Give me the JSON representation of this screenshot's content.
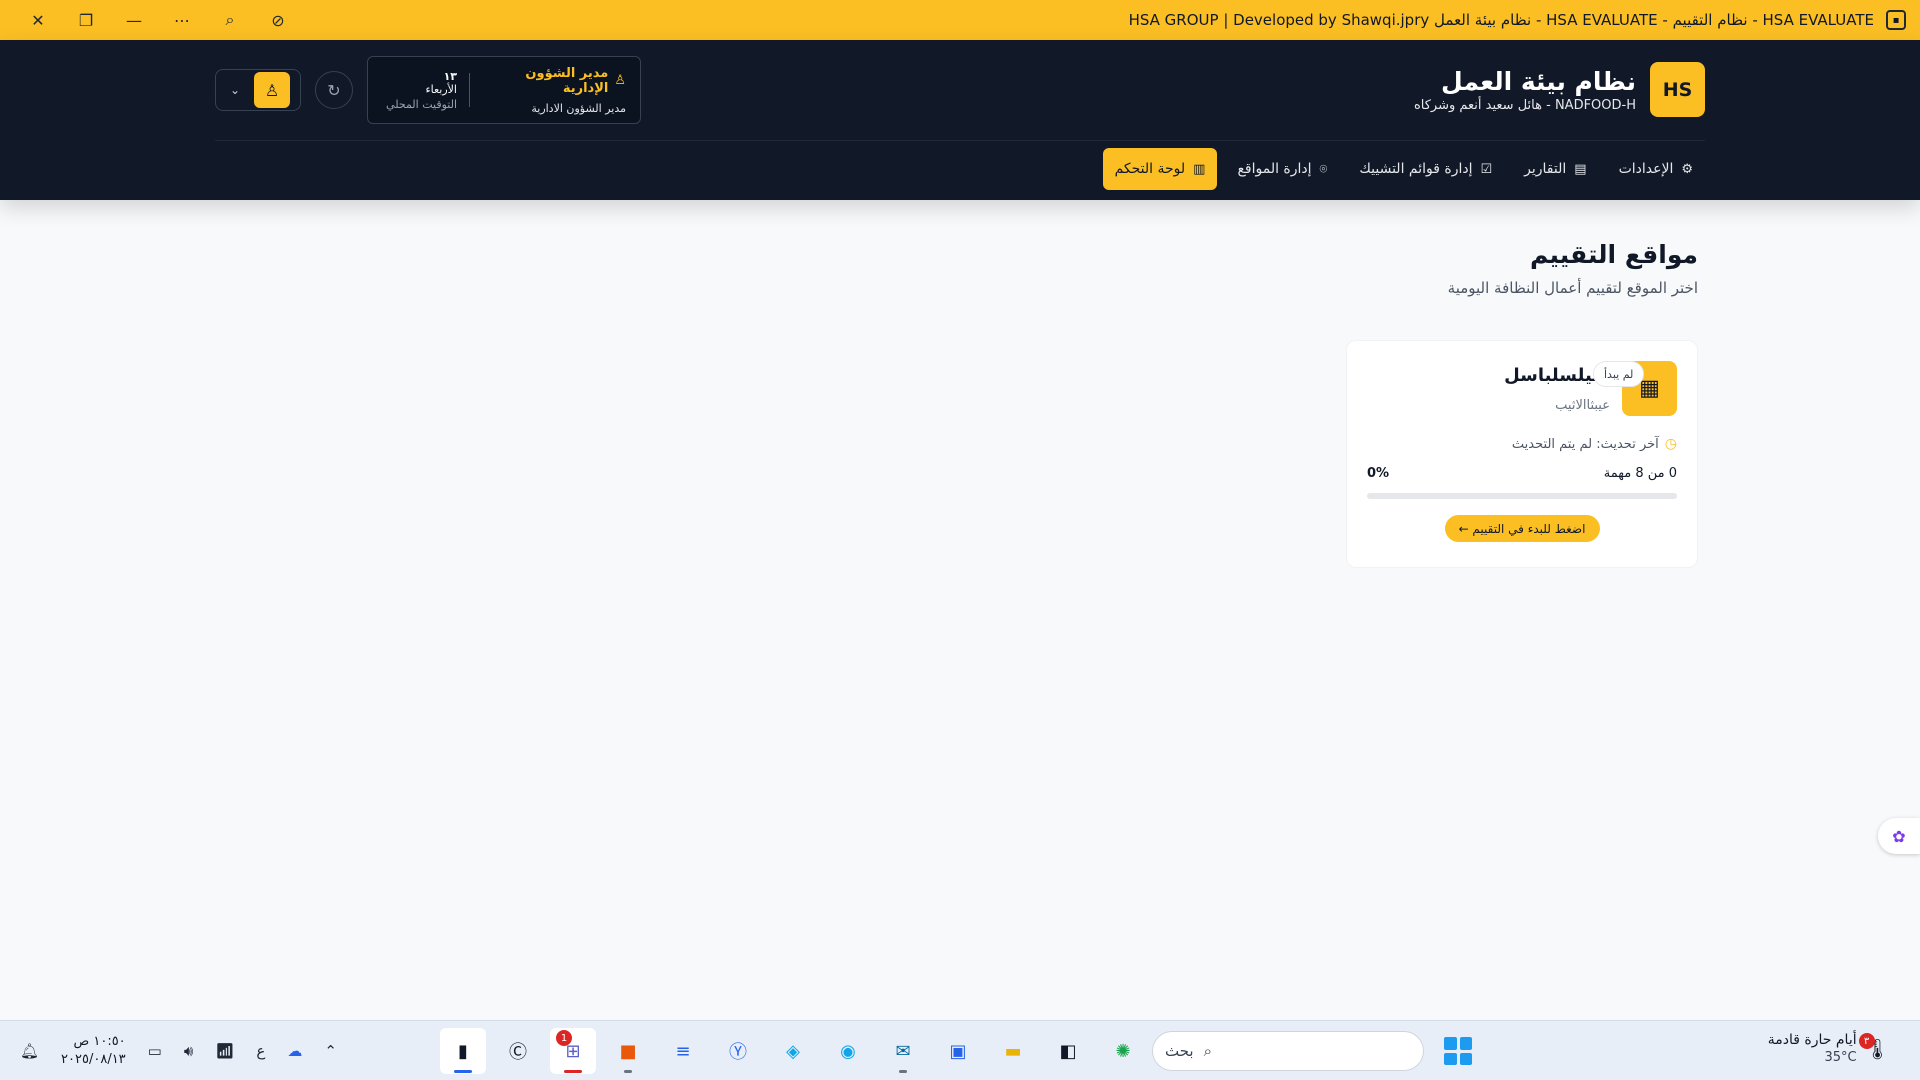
{
  "window": {
    "title": "HSA GROUP | Developed by Shawqi.jpry نظام بيئة العمل - HSA EVALUATE - نظام التقييم - HSA EVALUATE"
  },
  "header": {
    "logo_text": "HS",
    "brand_title": "نظام بيئة العمل",
    "brand_subtitle": "NADFOOD-H - هائل سعيد أنعم وشركاه",
    "user_role_title": "مدير الشؤون الإدارية",
    "user_role_subtitle": "مدير الشؤون الادارية",
    "date_num": "١٣",
    "day_name": "الأربعاء",
    "time_label": "التوقيت المحلي"
  },
  "nav": {
    "items": [
      {
        "label": "لوحة التحكم",
        "icon": "bar-chart-icon",
        "active": true
      },
      {
        "label": "إدارة المواقع",
        "icon": "map-pin-icon",
        "active": false
      },
      {
        "label": "إدارة قوائم التشييك",
        "icon": "checkbox-icon",
        "active": false
      },
      {
        "label": "التقارير",
        "icon": "file-text-icon",
        "active": false
      },
      {
        "label": "الإعدادات",
        "icon": "gear-icon",
        "active": false
      }
    ]
  },
  "main": {
    "title": "مواقع التقييم",
    "subtitle": "اختر الموقع لتقييم أعمال النظافة اليومية",
    "site": {
      "name": "سيلسلباسل",
      "sub": "عيبثاالاثيب",
      "status": "لم يبدأ",
      "last_update": "آخر تحديث: لم يتم التحديث",
      "tasks": "0 من 8 مهمة",
      "percent": "0%",
      "progress": 0,
      "button": "اضغط للبدء في التقييم ←"
    }
  },
  "taskbar": {
    "time": "١٠:٥٠ ص",
    "date": "٢٠٢٥/٠٨/١٣",
    "lang": "ع",
    "search_placeholder": "بحث",
    "teams_badge": "1",
    "weather_title": "أيام حارة قادمة",
    "weather_temp": "35°C",
    "weather_badge": "٣"
  },
  "colors": {
    "accent": "#fbbf24",
    "header_bg": "#111827",
    "page_bg": "#f8f9fb"
  }
}
